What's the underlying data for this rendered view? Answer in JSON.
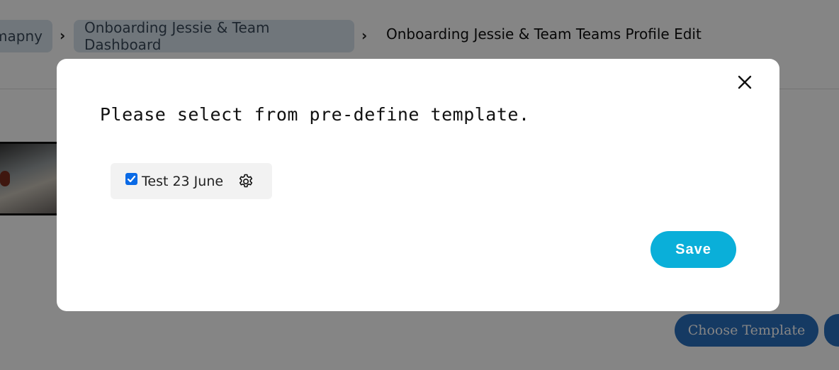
{
  "breadcrumb": {
    "items": [
      {
        "label": "mapny"
      },
      {
        "label": "Onboarding Jessie & Team Dashboard"
      },
      {
        "label": "Onboarding Jessie & Team Teams Profile Edit"
      }
    ],
    "separator_icon": "chevron-right-icon"
  },
  "page": {
    "choose_template_label": "Choose Template"
  },
  "modal": {
    "title": "Please select from pre-define template.",
    "close_icon": "close-icon",
    "options": [
      {
        "label": "Test 23 June",
        "checked": true,
        "settings_icon": "gear-icon"
      }
    ],
    "save_label": "Save"
  },
  "colors": {
    "accent": "#0aafd9",
    "checkbox": "#0a6ae6",
    "secondary_button": "#2a6fbf"
  }
}
